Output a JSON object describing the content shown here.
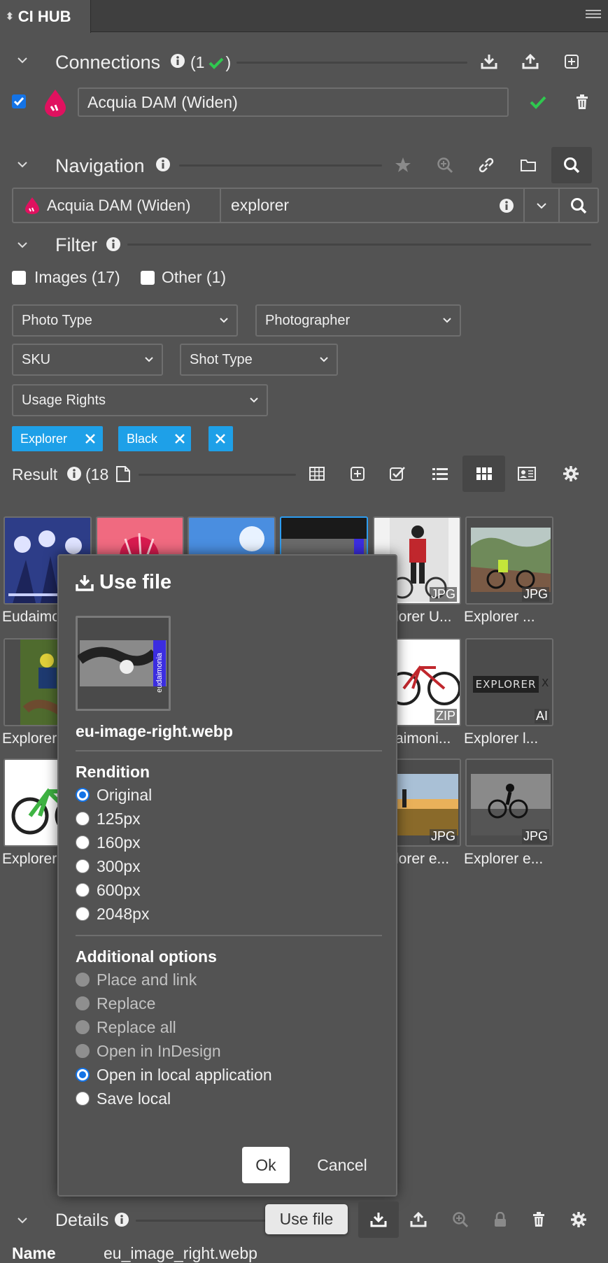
{
  "app": {
    "tab_title": "CI HUB"
  },
  "connections": {
    "title": "Connections",
    "count_text": "(1",
    "count_close": ")",
    "item": {
      "name": "Acquia DAM (Widen)",
      "checked": true
    }
  },
  "navigation": {
    "title": "Navigation",
    "source_label": "Acquia DAM (Widen)",
    "search_value": "explorer"
  },
  "filter": {
    "title": "Filter",
    "checkboxes": [
      {
        "label": "Images (17)"
      },
      {
        "label": "Other (1)"
      }
    ],
    "dropdowns": [
      {
        "label": "Photo Type"
      },
      {
        "label": "Photographer"
      },
      {
        "label": "SKU"
      },
      {
        "label": "Shot Type"
      },
      {
        "label": "Usage Rights"
      }
    ],
    "tags": [
      {
        "label": "Explorer"
      },
      {
        "label": "Black"
      }
    ]
  },
  "result": {
    "title": "Result",
    "count_text": "(18",
    "items": [
      {
        "label": "Eudaimonia",
        "format": ""
      },
      {
        "label": "",
        "format": ""
      },
      {
        "label": "",
        "format": ""
      },
      {
        "label": "",
        "format": ""
      },
      {
        "label": "lorer U...",
        "format": "JPG"
      },
      {
        "label": "Explorer ...",
        "format": "JPG"
      },
      {
        "label": "Explorer",
        "format": ""
      },
      {
        "label": "aimoni...",
        "format": "ZIP"
      },
      {
        "label": "Explorer l...",
        "format": "AI"
      },
      {
        "label": "Explorer",
        "format": ""
      },
      {
        "label": "lorer e...",
        "format": "JPG"
      },
      {
        "label": "Explorer e...",
        "format": "JPG"
      }
    ],
    "explorer_logo_text": "EXPLORER",
    "explorer_logo_x": "X",
    "eudaimonia_vertical": "eudaimonia"
  },
  "dialog": {
    "title": "Use file",
    "filename": "eu-image-right.webp",
    "rendition_title": "Rendition",
    "renditions": [
      "Original",
      "125px",
      "160px",
      "300px",
      "600px",
      "2048px"
    ],
    "selected_rendition": "Original",
    "options_title": "Additional options",
    "options": [
      {
        "label": "Place and link",
        "enabled": false
      },
      {
        "label": "Replace",
        "enabled": false
      },
      {
        "label": "Replace all",
        "enabled": false
      },
      {
        "label": "Open in InDesign",
        "enabled": false
      },
      {
        "label": "Open in local application",
        "enabled": true,
        "selected": true
      },
      {
        "label": "Save local",
        "enabled": true
      }
    ],
    "ok_label": "Ok",
    "cancel_label": "Cancel"
  },
  "details": {
    "title": "Details",
    "tooltip": "Use file",
    "name_label": "Name",
    "name_value": "eu_image_right.webp"
  },
  "colors": {
    "accent": "#1ea0e8",
    "check": "#2fc84f",
    "bg": "#535353",
    "brand": "#e0115f"
  }
}
